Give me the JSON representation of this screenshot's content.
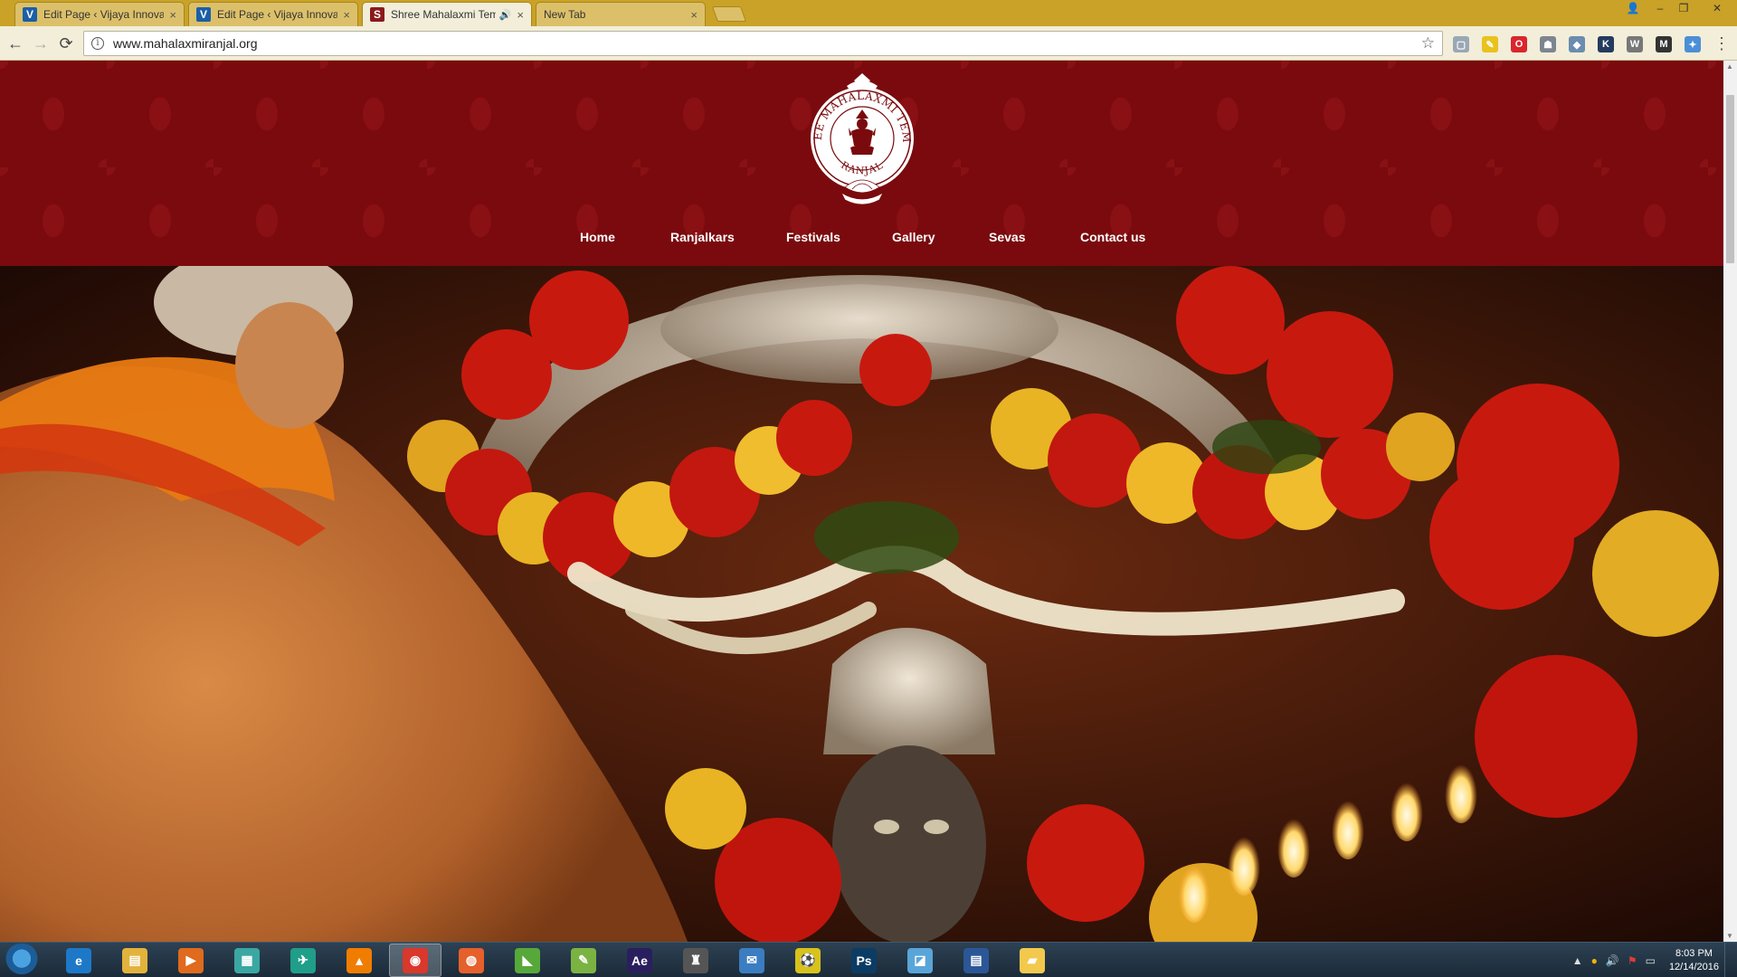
{
  "browser": {
    "tabs": [
      {
        "title": "Edit Page ‹ Vijaya Innovati",
        "favicon": "V",
        "favicon_color": "#1a5fa8",
        "active": false
      },
      {
        "title": "Edit Page ‹ Vijaya Innovati",
        "favicon": "V",
        "favicon_color": "#1a5fa8",
        "active": false
      },
      {
        "title": "Shree Mahalaxmi Tem",
        "favicon": "S",
        "favicon_color": "#8b1a1a",
        "active": true,
        "audio": true
      },
      {
        "title": "New Tab",
        "favicon": "",
        "favicon_color": "",
        "active": false
      }
    ],
    "tab_close": "×",
    "audio_icon": "🔊",
    "window_controls": {
      "user": "👤",
      "minimize": "–",
      "maximize": "❐",
      "close": "✕"
    },
    "address": "www.mahalaxmiranjal.org",
    "info_icon": "i",
    "star_icon": "☆",
    "back_icon": "←",
    "forward_icon": "→",
    "reload_icon": "⟳",
    "menu_icon": "⋮",
    "extensions": [
      {
        "name": "ext-grey-icon",
        "color": "#9aa7b5",
        "glyph": "▢"
      },
      {
        "name": "ext-pencil-icon",
        "color": "#e9c21c",
        "glyph": "✎"
      },
      {
        "name": "ext-opera-icon",
        "color": "#d9262c",
        "glyph": "O"
      },
      {
        "name": "ext-robot-icon",
        "color": "#7c8590",
        "glyph": "☗"
      },
      {
        "name": "ext-puzzle-icon",
        "color": "#6a8caf",
        "glyph": "◆"
      },
      {
        "name": "ext-k-icon",
        "color": "#243a5e",
        "glyph": "K"
      },
      {
        "name": "ext-wordpress-icon",
        "color": "#777777",
        "glyph": "W"
      },
      {
        "name": "ext-m-icon",
        "color": "#333333",
        "glyph": "M"
      },
      {
        "name": "ext-blue-icon",
        "color": "#4c8fd6",
        "glyph": "✦"
      }
    ],
    "accent": "#c9a227"
  },
  "site": {
    "header_color": "#7a0a0d",
    "logo": {
      "top_text": "SHREE MAHALAXMI TEMPLE",
      "bottom_text": "RANJAL"
    },
    "nav": [
      "Home",
      "Ranjalkars",
      "Festivals",
      "Gallery",
      "Sevas",
      "Contact us"
    ]
  },
  "taskbar": {
    "apps": [
      {
        "name": "internet-explorer-icon",
        "label": "e",
        "color": "#1e78c8"
      },
      {
        "name": "file-explorer-icon",
        "label": "▤",
        "color": "#e2b33c"
      },
      {
        "name": "media-player-icon",
        "label": "▶",
        "color": "#e06a1d"
      },
      {
        "name": "spreadsheet-app-icon",
        "label": "▦",
        "color": "#3aa7a2"
      },
      {
        "name": "bird-app-icon",
        "label": "✈",
        "color": "#1f9e8a"
      },
      {
        "name": "vlc-icon",
        "label": "▲",
        "color": "#f07d00"
      },
      {
        "name": "chrome-icon",
        "label": "◉",
        "color": "#d9382c",
        "active": true
      },
      {
        "name": "firefox-icon",
        "label": "◍",
        "color": "#e6602b"
      },
      {
        "name": "green-app-icon",
        "label": "◣",
        "color": "#57a83a"
      },
      {
        "name": "notepad-plus-icon",
        "label": "✎",
        "color": "#7bb342"
      },
      {
        "name": "after-effects-icon",
        "label": "Ae",
        "color": "#2a1f5e"
      },
      {
        "name": "tower-app-icon",
        "label": "♜",
        "color": "#555555"
      },
      {
        "name": "thunderbird-icon",
        "label": "✉",
        "color": "#3b7dc1"
      },
      {
        "name": "soccer-app-icon",
        "label": "⚽",
        "color": "#d8c21b"
      },
      {
        "name": "photoshop-icon",
        "label": "Ps",
        "color": "#0c3c63"
      },
      {
        "name": "blue-tool-icon",
        "label": "◪",
        "color": "#5aa5d8"
      },
      {
        "name": "document-icon",
        "label": "▤",
        "color": "#2b5797"
      },
      {
        "name": "folder-icon",
        "label": "▰",
        "color": "#f2c94c"
      }
    ],
    "tray": [
      "▲",
      "●",
      "🔊",
      "⚑",
      "▭"
    ],
    "time": "8:03 PM",
    "date": "12/14/2016"
  }
}
